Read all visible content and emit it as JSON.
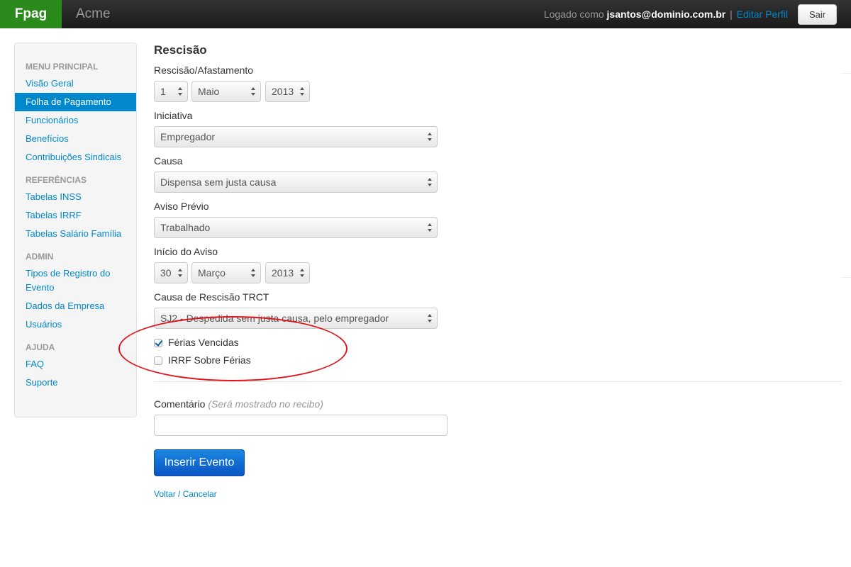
{
  "topbar": {
    "brand": "Fpag",
    "company": "Acme",
    "logged_in_prefix": "Logado como",
    "user_email": "jsantos@dominio.com.br",
    "separator": "|",
    "edit_profile": "Editar Perfil",
    "logout": "Sair"
  },
  "sidebar": {
    "sections": [
      {
        "header": "MENU PRINCIPAL",
        "items": [
          "Visão Geral",
          "Folha de Pagamento",
          "Funcionários",
          "Benefícios",
          "Contribuições Sindicais"
        ]
      },
      {
        "header": "REFERÊNCIAS",
        "items": [
          "Tabelas INSS",
          "Tabelas IRRF",
          "Tabelas Salário Família"
        ]
      },
      {
        "header": "ADMIN",
        "items": [
          "Tipos de Registro do Evento",
          "Dados da Empresa",
          "Usuários"
        ]
      },
      {
        "header": "AJUDA",
        "items": [
          "FAQ",
          "Suporte"
        ]
      }
    ],
    "active_item": "Folha de Pagamento"
  },
  "form": {
    "title": "Rescisão",
    "rescisao_label": "Rescisão/Afastamento",
    "rescisao_day": "1",
    "rescisao_month": "Maio",
    "rescisao_year": "2013",
    "iniciativa_label": "Iniciativa",
    "iniciativa_value": "Empregador",
    "causa_label": "Causa",
    "causa_value": "Dispensa sem justa causa",
    "aviso_label": "Aviso Prévio",
    "aviso_value": "Trabalhado",
    "inicio_label": "Início do Aviso",
    "inicio_day": "30",
    "inicio_month": "Março",
    "inicio_year": "2013",
    "trct_label": "Causa de Rescisão TRCT",
    "trct_value": "SJ2 - Despedida sem justa causa, pelo empregador",
    "ferias_vencidas_label": "Férias Vencidas",
    "ferias_vencidas_checked": true,
    "irrf_ferias_label": "IRRF Sobre Férias",
    "irrf_ferias_checked": false,
    "comment_label": "Comentário",
    "comment_hint": "(Será mostrado no recibo)",
    "comment_value": "",
    "submit": "Inserir Evento",
    "back": "Voltar / Cancelar"
  },
  "colors": {
    "brand_green": "#2b8a1c",
    "link_blue": "#0088cc",
    "primary_button": "#0b55c4",
    "highlight_red": "#e0141b"
  }
}
